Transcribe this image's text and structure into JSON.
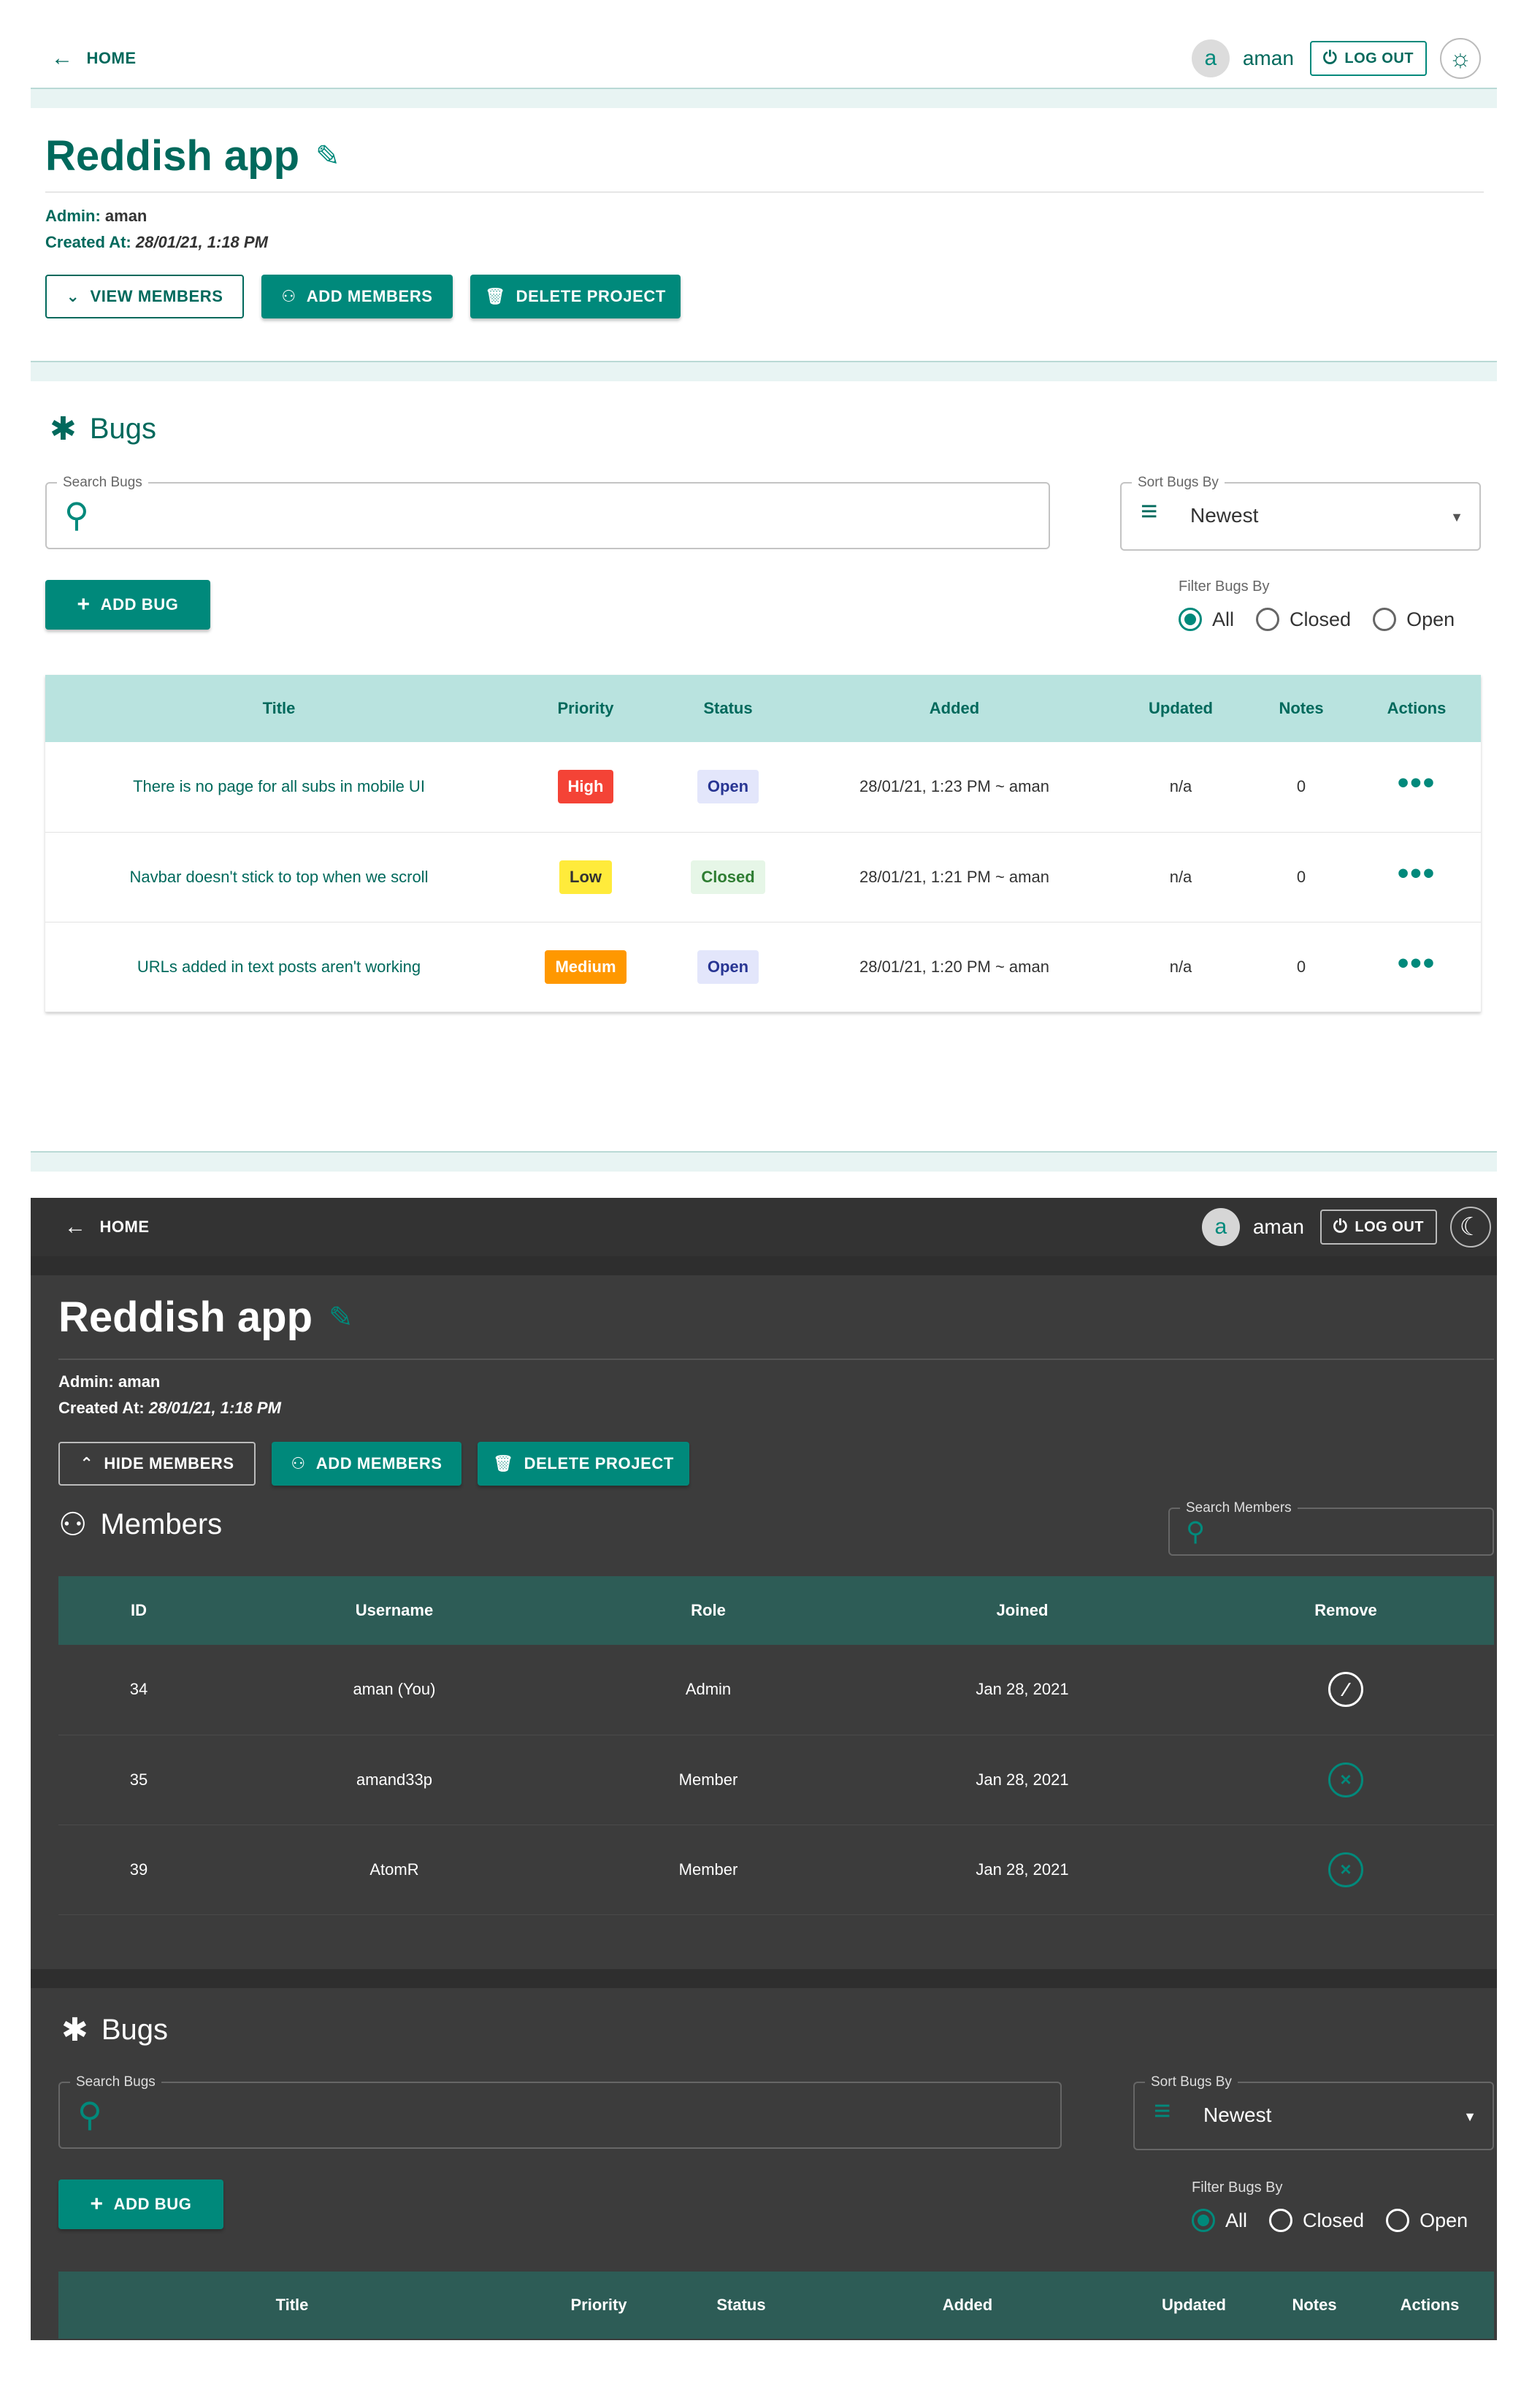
{
  "light": {
    "nav": {
      "home_label": "HOME",
      "avatar_letter": "a",
      "username": "aman",
      "logout_label": "LOG OUT"
    },
    "project": {
      "title": "Reddish app",
      "admin_label": "Admin:",
      "admin_value": "aman",
      "created_label": "Created At:",
      "created_value": "28/01/21, 1:18 PM",
      "view_members_label": "VIEW MEMBERS",
      "add_members_label": "ADD MEMBERS",
      "delete_project_label": "DELETE PROJECT"
    },
    "bugs": {
      "heading": "Bugs",
      "search_label": "Search Bugs",
      "sort_label": "Sort Bugs By",
      "sort_value": "Newest",
      "add_bug_label": "ADD BUG",
      "filter_label": "Filter Bugs By",
      "filter_options": [
        "All",
        "Closed",
        "Open"
      ],
      "filter_selected": "All",
      "columns": [
        "Title",
        "Priority",
        "Status",
        "Added",
        "Updated",
        "Notes",
        "Actions"
      ],
      "rows": [
        {
          "title": "There is no page for all subs in mobile UI",
          "priority": "High",
          "status": "Open",
          "added": "28/01/21, 1:23 PM ~ aman",
          "updated": "n/a",
          "notes": "0"
        },
        {
          "title": "Navbar doesn't stick to top when we scroll",
          "priority": "Low",
          "status": "Closed",
          "added": "28/01/21, 1:21 PM ~ aman",
          "updated": "n/a",
          "notes": "0"
        },
        {
          "title": "URLs added in text posts aren't working",
          "priority": "Medium",
          "status": "Open",
          "added": "28/01/21, 1:20 PM ~ aman",
          "updated": "n/a",
          "notes": "0"
        }
      ]
    }
  },
  "dark": {
    "nav": {
      "home_label": "HOME",
      "avatar_letter": "a",
      "username": "aman",
      "logout_label": "LOG OUT"
    },
    "project": {
      "title": "Reddish app",
      "admin_label": "Admin:",
      "admin_value": "aman",
      "created_label": "Created At:",
      "created_value": "28/01/21, 1:18 PM",
      "hide_members_label": "HIDE MEMBERS",
      "add_members_label": "ADD MEMBERS",
      "delete_project_label": "DELETE PROJECT"
    },
    "members": {
      "heading": "Members",
      "search_label": "Search Members",
      "columns": [
        "ID",
        "Username",
        "Role",
        "Joined",
        "Remove"
      ],
      "rows": [
        {
          "id": "34",
          "username": "aman (You)",
          "role": "Admin",
          "joined": "Jan 28, 2021",
          "removable": false
        },
        {
          "id": "35",
          "username": "amand33p",
          "role": "Member",
          "joined": "Jan 28, 2021",
          "removable": true
        },
        {
          "id": "39",
          "username": "AtomR",
          "role": "Member",
          "joined": "Jan 28, 2021",
          "removable": true
        }
      ]
    },
    "bugs": {
      "heading": "Bugs",
      "search_label": "Search Bugs",
      "sort_label": "Sort Bugs By",
      "sort_value": "Newest",
      "add_bug_label": "ADD BUG",
      "filter_label": "Filter Bugs By",
      "filter_options": [
        "All",
        "Closed",
        "Open"
      ],
      "filter_selected": "All",
      "columns": [
        "Title",
        "Priority",
        "Status",
        "Added",
        "Updated",
        "Notes",
        "Actions"
      ]
    }
  },
  "colors": {
    "accent": "#00897b",
    "accent_dark_text": "#00695c",
    "light_band": "#e8f4f3",
    "table_head_light": "#b9e3df",
    "table_head_dark": "#2d5c56",
    "priority_high": "#f44336",
    "priority_low": "#ffeb3b",
    "priority_medium": "#ff9800",
    "status_open_bg": "#e3e6fb",
    "status_open_text": "#283593",
    "status_closed_bg": "#e6f6e7",
    "status_closed_text": "#2e7d32",
    "dark_bg": "#3c3c3c",
    "dark_nav": "#333333"
  }
}
